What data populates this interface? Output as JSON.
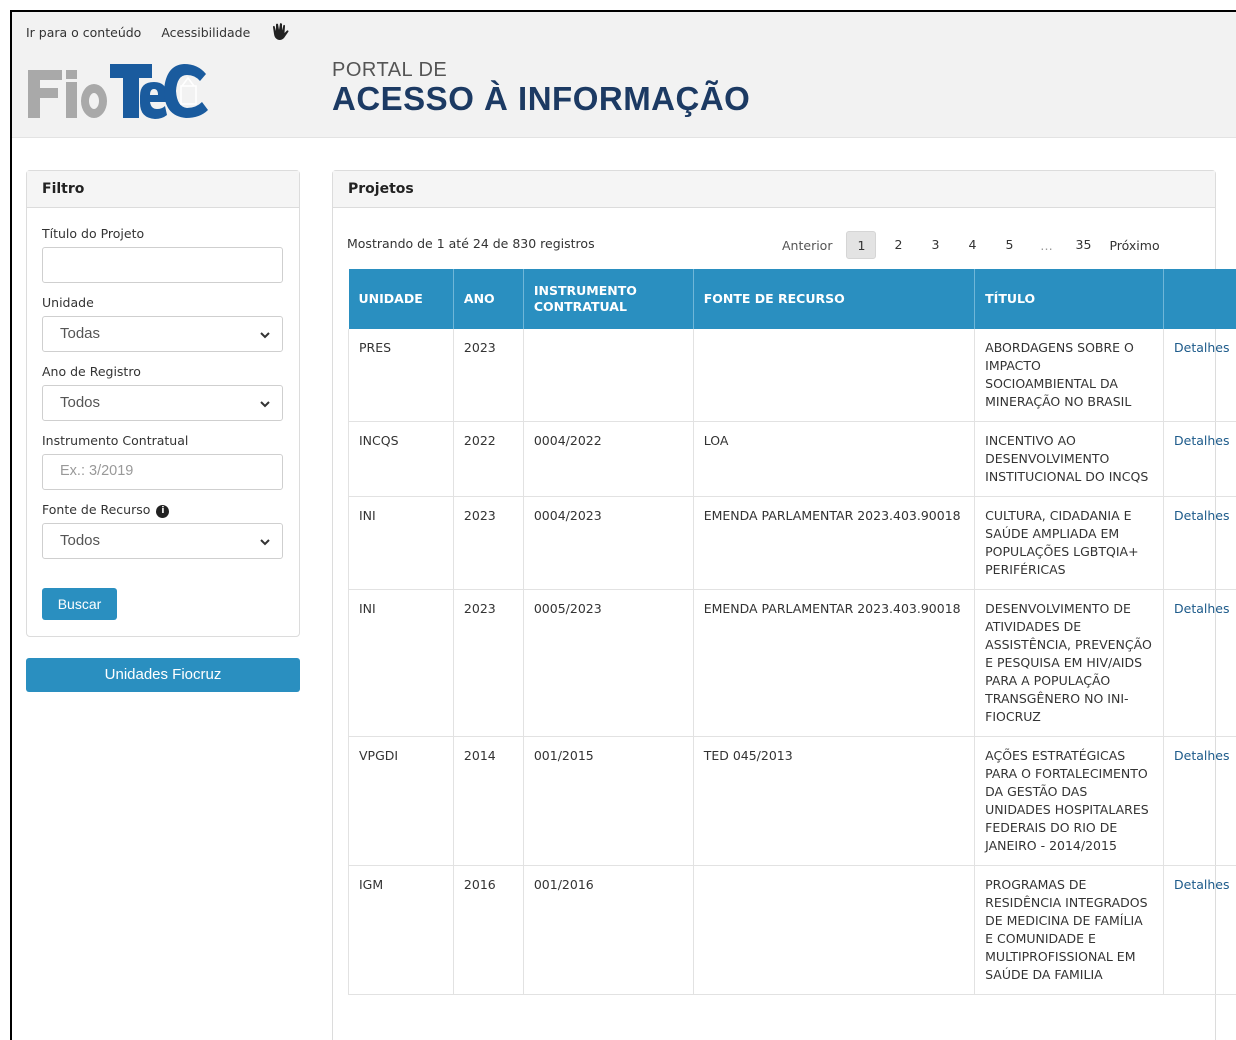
{
  "top_links": {
    "skip": "Ir para o conteúdo",
    "accessibility": "Acessibilidade"
  },
  "brand": {
    "logo_text": "FioTeC",
    "portal_subtitle": "PORTAL DE",
    "portal_title": "ACESSO À INFORMAÇÃO",
    "accent": "#1c3a63"
  },
  "filter": {
    "heading": "Filtro",
    "titulo_label": "Título do Projeto",
    "titulo_value": "",
    "unidade_label": "Unidade",
    "unidade_value": "Todas",
    "ano_label": "Ano de Registro",
    "ano_value": "Todos",
    "instrumento_label": "Instrumento Contratual",
    "instrumento_placeholder": "Ex.: 3/2019",
    "fonte_label": "Fonte de Recurso",
    "fonte_value": "Todos",
    "buscar_label": "Buscar"
  },
  "unidades_button": "Unidades Fiocruz",
  "projects": {
    "heading": "Projetos",
    "showing": "Mostrando de 1 até 24 de 830 registros",
    "pagination": {
      "prev": "Anterior",
      "pages": [
        "1",
        "2",
        "3",
        "4",
        "5"
      ],
      "ellipsis": "…",
      "last": "35",
      "next": "Próximo",
      "active": "1"
    },
    "columns": [
      "UNIDADE",
      "ANO",
      "INSTRUMENTO CONTRATUAL",
      "FONTE DE RECURSO",
      "TÍTULO",
      ""
    ],
    "rows": [
      {
        "unidade": "PRES",
        "ano": "2023",
        "instrumento": "",
        "fonte": "",
        "titulo": "ABORDAGENS SOBRE O IMPACTO SOCIOAMBIENTAL DA MINERAÇÃO NO BRASIL",
        "acao": "Detalhes"
      },
      {
        "unidade": "INCQS",
        "ano": "2022",
        "instrumento": "0004/2022",
        "fonte": "LOA",
        "titulo": "INCENTIVO AO DESENVOLVIMENTO INSTITUCIONAL DO INCQS",
        "acao": "Detalhes"
      },
      {
        "unidade": "INI",
        "ano": "2023",
        "instrumento": "0004/2023",
        "fonte": "EMENDA PARLAMENTAR 2023.403.90018",
        "titulo": "CULTURA, CIDADANIA E SAÚDE AMPLIADA EM POPULAÇÕES LGBTQIA+ PERIFÉRICAS",
        "acao": "Detalhes"
      },
      {
        "unidade": "INI",
        "ano": "2023",
        "instrumento": "0005/2023",
        "fonte": "EMENDA PARLAMENTAR 2023.403.90018",
        "titulo": "DESENVOLVIMENTO DE ATIVIDADES DE ASSISTÊNCIA, PREVENÇÃO E PESQUISA EM HIV/AIDS PARA A POPULAÇÃO TRANSGÊNERO NO INI-FIOCRUZ",
        "acao": "Detalhes"
      },
      {
        "unidade": "VPGDI",
        "ano": "2014",
        "instrumento": "001/2015",
        "fonte": "TED 045/2013",
        "titulo": "AÇÕES ESTRATÉGICAS PARA O FORTALECIMENTO DA GESTÃO DAS UNIDADES HOSPITALARES FEDERAIS DO RIO DE JANEIRO - 2014/2015",
        "acao": "Detalhes"
      },
      {
        "unidade": "IGM",
        "ano": "2016",
        "instrumento": "001/2016",
        "fonte": "",
        "titulo": "PROGRAMAS DE RESIDÊNCIA INTEGRADOS DE MEDICINA DE FAMÍLIA E COMUNIDADE E MULTIPROFISSIONAL EM SAÚDE DA FAMILIA",
        "acao": "Detalhes"
      }
    ]
  },
  "colors": {
    "primary": "#2a8fc0",
    "header_bg": "#f2f2f2"
  }
}
